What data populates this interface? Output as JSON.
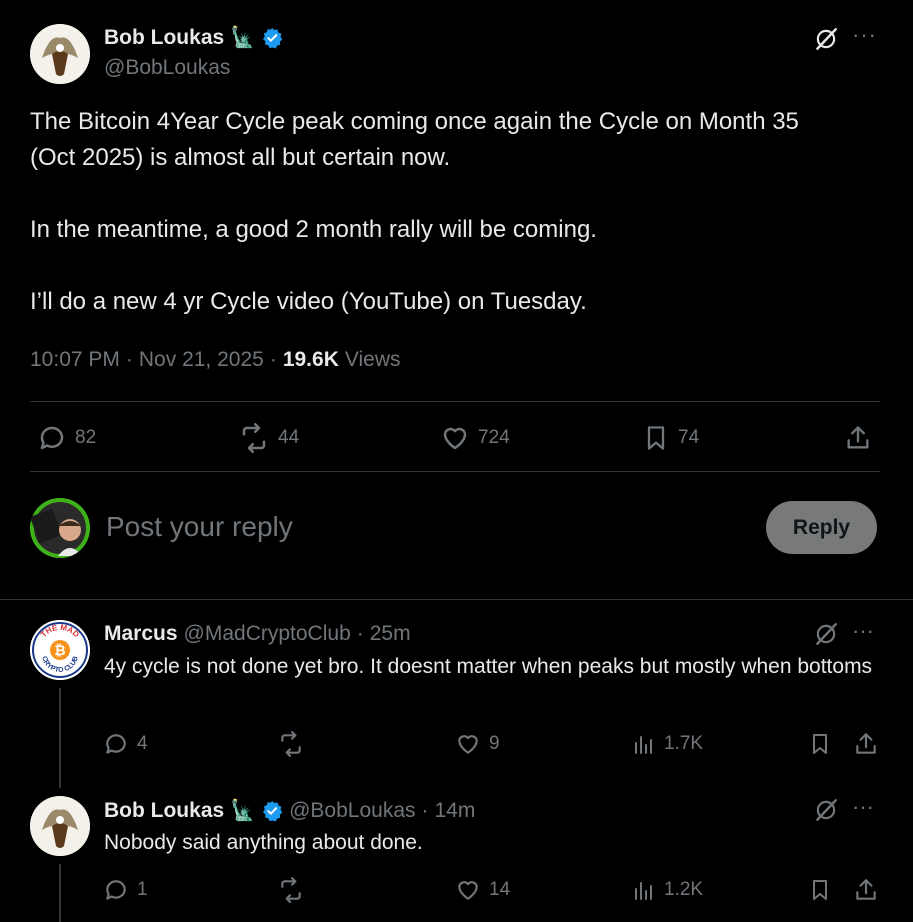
{
  "tweet": {
    "author_name": "Bob Loukas",
    "author_emoji": "🗽",
    "author_handle": "@BobLoukas",
    "text": "The Bitcoin 4Year Cycle peak coming once again the Cycle on Month 35\n(Oct 2025) is almost all but certain now.\n\nIn the meantime, a good 2 month rally will be coming.\n\nI’ll do a new 4 yr Cycle video (YouTube) on Tuesday.",
    "time": "10:07 PM",
    "date": "Nov 21, 2025",
    "views_count": "19.6K",
    "views_label": "Views",
    "replies": "82",
    "reposts": "44",
    "likes": "724",
    "bookmarks": "74"
  },
  "reply_box": {
    "placeholder": "Post your reply",
    "button_label": "Reply"
  },
  "replies": [
    {
      "name": "Marcus",
      "handle": "@MadCryptoClub",
      "age": "25m",
      "avatar_text": "THE MAD CRYPTO CLUB",
      "text": "4y cycle is not done yet bro. It doesnt matter when peaks but mostly when bottoms",
      "replies": "4",
      "reposts": "",
      "likes": "9",
      "views": "1.7K"
    },
    {
      "name": "Bob Loukas",
      "emoji": "🗽",
      "handle": "@BobLoukas",
      "age": "14m",
      "text": "Nobody said anything about done.",
      "replies": "1",
      "reposts": "",
      "likes": "14",
      "views": "1.2K"
    }
  ],
  "colors": {
    "background": "#000000",
    "text": "#e7e9ea",
    "muted": "#71767b",
    "verified": "#1d9bf0",
    "divider": "#2f3336"
  },
  "separator": "·"
}
